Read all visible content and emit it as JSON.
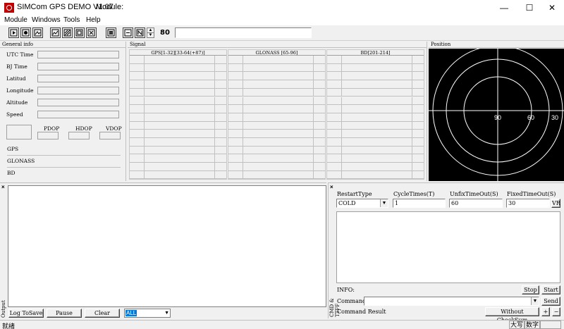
{
  "window": {
    "title": "SIMCom GPS DEMO V1.07",
    "module_label": "Module:",
    "minimize": "—",
    "maximize": "☐",
    "close": "✕"
  },
  "menu": [
    "Module",
    "Windows",
    "Tools",
    "Help"
  ],
  "toolbar": {
    "value": "80",
    "input_value": ""
  },
  "general_info": {
    "title": "General info",
    "fields": [
      "UTC Time",
      "BJ Time",
      "Latitud",
      "Longitude",
      "Altitude",
      "Speed"
    ],
    "dop_labels": [
      "PDOP",
      "HDOP",
      "VDOP"
    ],
    "systems": [
      "GPS",
      "GLONASS",
      "BD"
    ]
  },
  "signal": {
    "title": "Signal",
    "columns": [
      "GPS[1-32][33-64(+87)]",
      "GLONASS [65-96]",
      "BD[201-214]"
    ]
  },
  "position": {
    "title": "Position",
    "labels": [
      "90",
      "60",
      "30"
    ]
  },
  "output": {
    "label": "Output",
    "buttons": [
      "Log ToSave",
      "Pause",
      "Clear"
    ],
    "filter_value": "ALL"
  },
  "cmd": {
    "side_label": "CMD & TTFF",
    "headers": [
      "RestartType",
      "CycleTimes(T)",
      "UnfixTimeOut(S)",
      "FixedTimeOut(S)"
    ],
    "restart_type": "COLD",
    "cycle_times": "1",
    "unfix_timeout": "60",
    "fixed_timeout": "30",
    "vr_label": "VR",
    "info_label": "INFO:",
    "stop": "Stop",
    "start": "Start",
    "command_label": "Command",
    "command_value": "",
    "send": "Send",
    "result_label": "Command Result",
    "checksum": "Without CheckSum",
    "plus": "+",
    "minus": "−"
  },
  "status": {
    "left": "就绪",
    "caps": "大写",
    "num": "数字"
  }
}
